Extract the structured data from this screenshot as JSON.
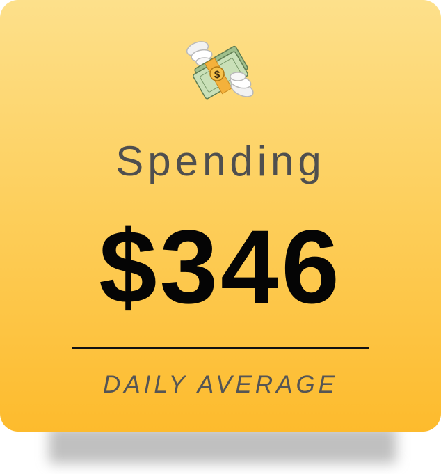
{
  "card": {
    "icon": "money-with-wings-icon",
    "title": "Spending",
    "amount": "$346",
    "caption": "DAILY AVERAGE"
  },
  "colors": {
    "card_top": "#fde08b",
    "card_bottom": "#fdbb2d",
    "title_text": "#4f4f4f",
    "amount_text": "#050505",
    "caption_text": "#555555"
  }
}
